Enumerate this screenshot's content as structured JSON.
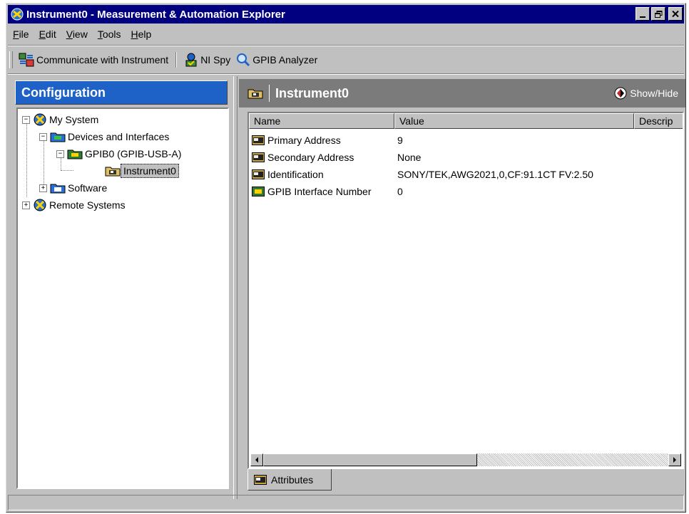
{
  "window": {
    "title": "Instrument0 - Measurement & Automation Explorer",
    "minimize_label": "_",
    "maximize_label": "▫",
    "close_label": "✕"
  },
  "menu": [
    {
      "label": "File",
      "u": "F",
      "rest": "ile"
    },
    {
      "label": "Edit",
      "u": "E",
      "rest": "dit"
    },
    {
      "label": "View",
      "u": "V",
      "rest": "iew"
    },
    {
      "label": "Tools",
      "u": "T",
      "rest": "ools"
    },
    {
      "label": "Help",
      "u": "H",
      "rest": "elp"
    }
  ],
  "toolbar": {
    "communicate_label": "Communicate with Instrument",
    "nispy_label": "NI Spy",
    "gpib_analyzer_label": "GPIB Analyzer"
  },
  "left_pane": {
    "header": "Configuration",
    "tree": {
      "my_system": "My System",
      "devices_and_interfaces": "Devices and Interfaces",
      "gpib0": "GPIB0 (GPIB-USB-A)",
      "instrument0": "Instrument0",
      "software": "Software",
      "remote_systems": "Remote Systems"
    }
  },
  "right_pane": {
    "title": "Instrument0",
    "show_hide_label": "Show/Hide",
    "columns": [
      "Name",
      "Value",
      "Descrip"
    ],
    "rows": [
      {
        "name": "Primary Address",
        "value": "9"
      },
      {
        "name": "Secondary Address",
        "value": "None"
      },
      {
        "name": "Identification",
        "value": "SONY/TEK,AWG2021,0,CF:91.1CT FV:2.50"
      },
      {
        "name": "GPIB Interface Number",
        "value": "0"
      }
    ],
    "tab_label": "Attributes"
  },
  "colors": {
    "titlebar": "#000080",
    "config_header": "#1e62c8",
    "right_header": "#7b7b7b",
    "chrome": "#c0c0c0"
  }
}
